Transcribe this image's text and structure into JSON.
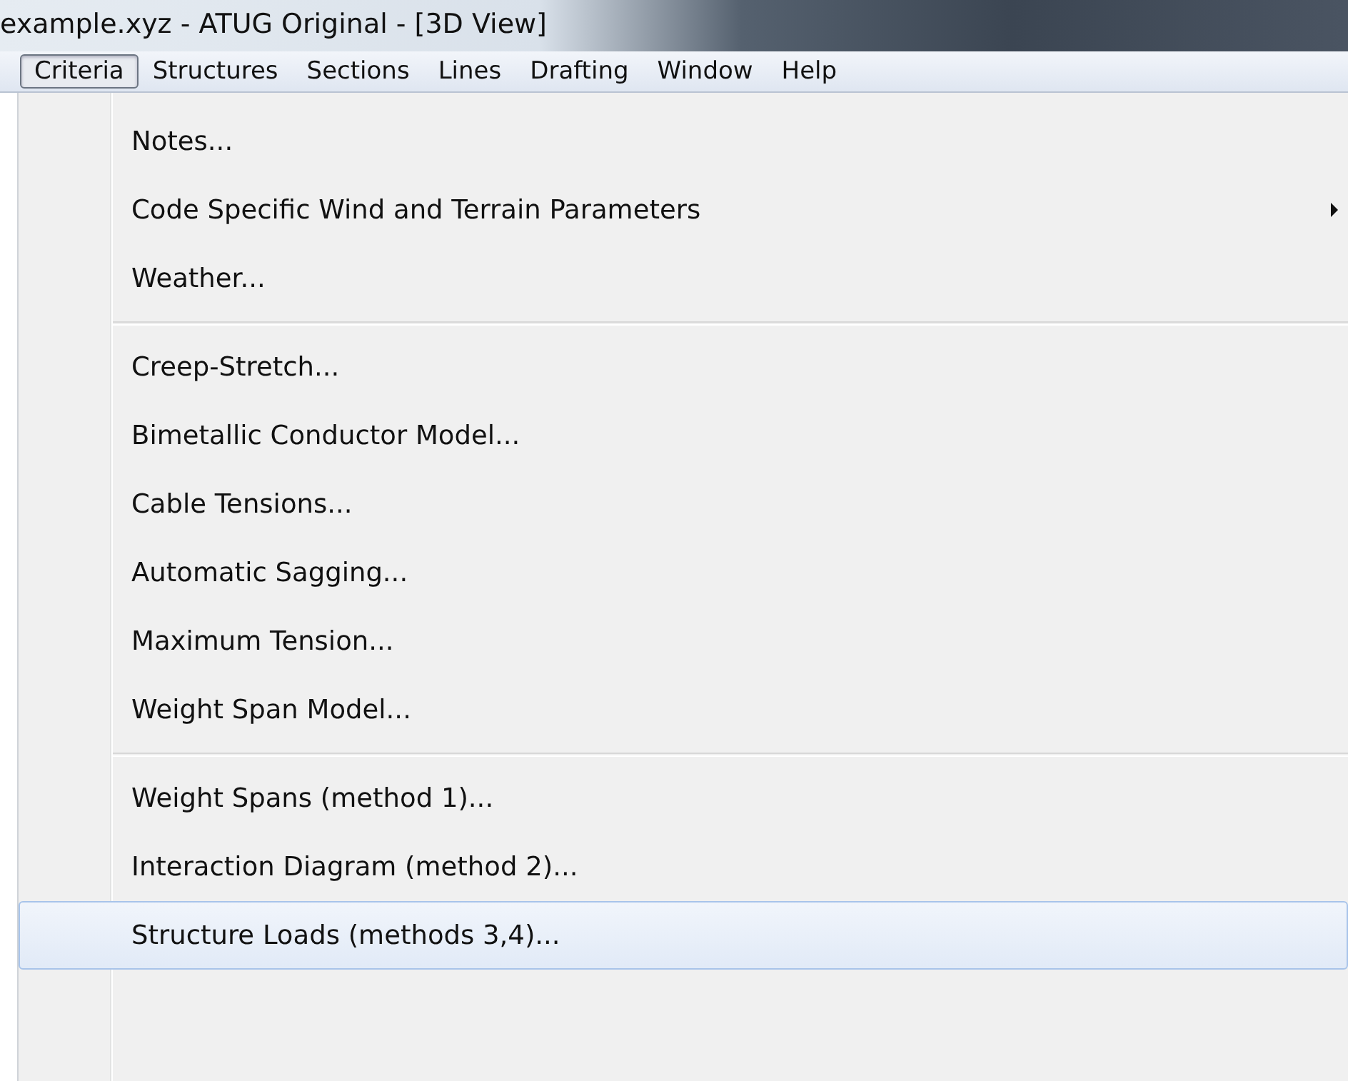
{
  "window": {
    "title": "example.xyz - ATUG Original - [3D View]"
  },
  "menubar": [
    {
      "label": "Criteria",
      "selected": true
    },
    {
      "label": "Structures",
      "selected": false
    },
    {
      "label": "Sections",
      "selected": false
    },
    {
      "label": "Lines",
      "selected": false
    },
    {
      "label": "Drafting",
      "selected": false
    },
    {
      "label": "Window",
      "selected": false
    },
    {
      "label": "Help",
      "selected": false
    }
  ],
  "menu": [
    {
      "kind": "item",
      "label": "Notes...",
      "selected": false,
      "submenu": false
    },
    {
      "kind": "item",
      "label": "Code Specific Wind and Terrain Parameters",
      "selected": false,
      "submenu": true
    },
    {
      "kind": "item",
      "label": "Weather...",
      "selected": false,
      "submenu": false
    },
    {
      "kind": "separator"
    },
    {
      "kind": "item",
      "label": "Creep-Stretch...",
      "selected": false,
      "submenu": false
    },
    {
      "kind": "item",
      "label": "Bimetallic Conductor Model...",
      "selected": false,
      "submenu": false
    },
    {
      "kind": "item",
      "label": "Cable Tensions...",
      "selected": false,
      "submenu": false
    },
    {
      "kind": "item",
      "label": "Automatic Sagging...",
      "selected": false,
      "submenu": false
    },
    {
      "kind": "item",
      "label": "Maximum Tension...",
      "selected": false,
      "submenu": false
    },
    {
      "kind": "item",
      "label": "Weight Span Model...",
      "selected": false,
      "submenu": false
    },
    {
      "kind": "separator"
    },
    {
      "kind": "item",
      "label": "Weight Spans (method 1)...",
      "selected": false,
      "submenu": false
    },
    {
      "kind": "item",
      "label": "Interaction Diagram (method 2)...",
      "selected": false,
      "submenu": false
    },
    {
      "kind": "item",
      "label": "Structure Loads (methods 3,4)...",
      "selected": true,
      "submenu": false
    }
  ]
}
